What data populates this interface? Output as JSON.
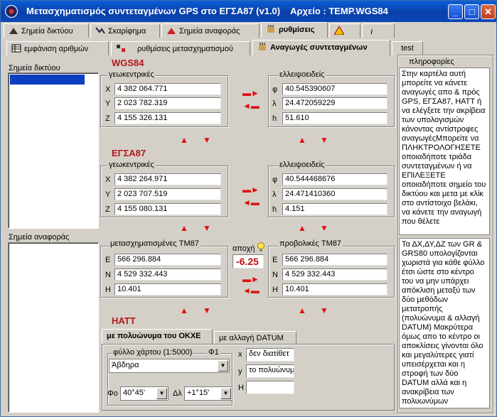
{
  "window": {
    "title": "Μετασχηματισμός συντεταγμένων GPS στο ΕΓΣΑ87   (v1.0)",
    "file_label": "Αρχείο : TEMP.WGS84",
    "minimize": "_",
    "maximize": "□",
    "close": "✕"
  },
  "main_tabs": [
    "Σημεία δικτύου",
    "Σκαρίφημα",
    "Σημεία αναφοράς",
    "ρυθμίσεις"
  ],
  "sub_tabs": [
    "εμφάνιση αριθμών",
    "ρυθμίσεις μετασχηματισμού",
    "Αναγωγές συντεταγμένων",
    "test"
  ],
  "left": {
    "network_label": "Σημεία δικτύου",
    "reference_label": "Σημεία αναφοράς"
  },
  "wgs84": {
    "title": "WGS84",
    "geocentric_label": "γεωκεντρικές",
    "ellipsoidal_label": "ελλειψοειδείς",
    "X": "4 382 064.771",
    "Y": "2 023 782.319",
    "Z": "4 155 326.131",
    "phi": "40.545390607",
    "lambda": "24.472059229",
    "h": "51.610"
  },
  "egsa87": {
    "title": "ΕΓΣΑ87",
    "geocentric_label": "γεωκεντρικές",
    "ellipsoidal_label": "ελλειψοειδείς",
    "X": "4 382 264.971",
    "Y": "2 023 707.519",
    "Z": "4 155 080.131",
    "phi": "40.544468676",
    "lambda": "24.471410360",
    "h": "4.151"
  },
  "tm87": {
    "transformed_label": "μετασχηματισμένες TM87",
    "projected_label": "προβολικές TM87",
    "E1": "566 296.884",
    "N1": "4 529 332.443",
    "H1": "10.401",
    "E2": "566 296.884",
    "N2": "4 529 332.443",
    "H2": "10.401",
    "deviation_label": "αποχή",
    "deviation": "-6.25"
  },
  "axes": {
    "X": "X",
    "Y": "Y",
    "Z": "Z",
    "phi": "φ",
    "lambda": "λ",
    "h": "h",
    "E": "E",
    "N": "N",
    "H": "H"
  },
  "hatt": {
    "title": "HATT",
    "tab1": "με πολυώνυμα του ΟΚΧΕ",
    "tab2": "με αλλαγή DATUM",
    "sheet_label": "φύλλο χάρτου (1:5000)",
    "phi1_label": "Φ1",
    "sheet_value": "Άβδηρα",
    "phi0_label": "Φο",
    "phi0_value": "40°45'",
    "dl_label": "Δλ",
    "dl_value": "+1°15'",
    "x_label": "x",
    "y_label": "y",
    "H_label": "H",
    "x_value": "δεν διατίθετ",
    "y_value": "το πολυώνυμ",
    "H_value": ""
  },
  "info": {
    "title": "πληροφορίες",
    "text1": "Στην καρτέλα αυτή μπορείτε να κάνετε αναγωγές απο & πρός GPS, ΕΓΣΑ87, HATT ή να ελέγξετε την ακρίβεια των υπολογισμών κάνοντας αντίστροφες αναγωγέςΜπορείτε να ΠΛΗΚΤΡΟΛΟΓΗΣΕΤΕ οποιαδήποτε τριάδα συντεταγμένων ή να ΕΠΙΛΕΞΕΤΕ οποιαδήποτε σημείο του δικτύου και μετα με κλίκ στο αντίστοιχο βελάκι, να κάνετε την αναγωγή που θέλετε",
    "text2": "Τα ΔΧ,ΔΥ,ΔΖ των GR & GRS80 υπολογίζονται χωριστά για κάθε φύλλο έτσι ώστε στο κέντρο του να μην υπάρχει απόκλιση μεταξύ των δύο μεθόδων μετατροπής (πολυώνυμα & αλλαγή DATUM) Μακρύτερα όμως απο το κέντρο οι αποκλίσεις γίνονται όλο και μεγαλύτερες γιατί υπεισέρχεται και η στροφή των δύο DATUM αλλά και η ανακρίβεια των πολυωνύμων"
  }
}
